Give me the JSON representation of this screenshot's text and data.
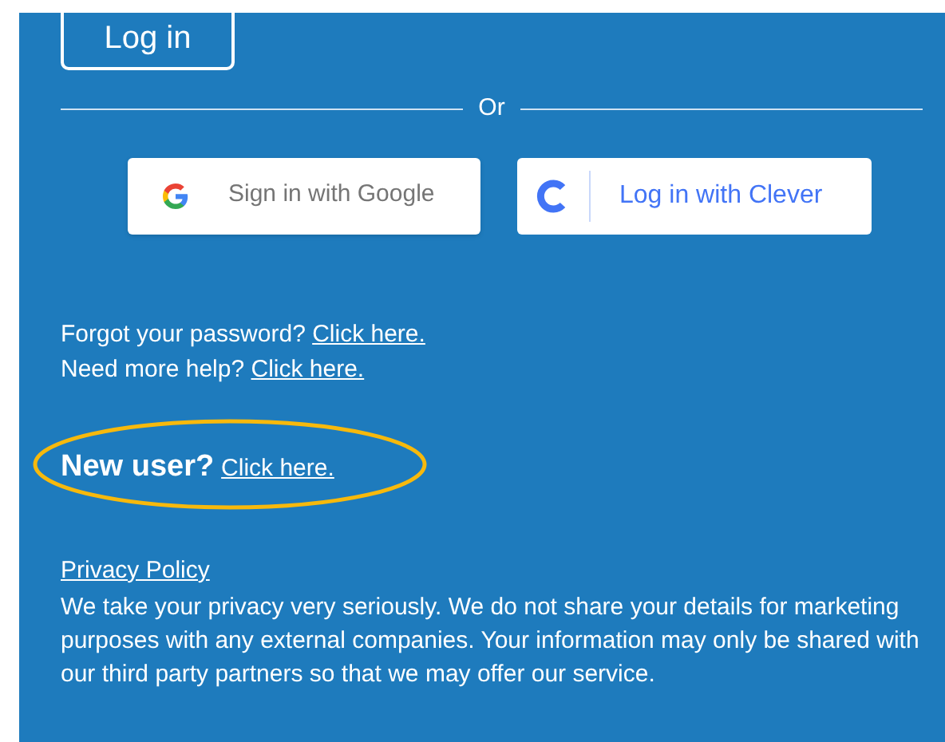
{
  "login_button": {
    "label": "Log in"
  },
  "divider": {
    "label": "Or"
  },
  "sso_buttons": [
    {
      "kind": "google",
      "label": "Sign in with Google"
    },
    {
      "kind": "clever",
      "label": "Log in with Clever"
    }
  ],
  "help_lines": [
    {
      "text": "Forgot your password?",
      "link": "Click here."
    },
    {
      "text": "Need more help?",
      "link": "Click here."
    }
  ],
  "new_user": {
    "text": "New user?",
    "link": "Click here.",
    "highlighted": true
  },
  "privacy": {
    "link": "Privacy Policy",
    "text": "We take your privacy very seriously. We do not share your details for marketing purposes with any external companies. Your information may only be shared with our third party partners so that we may offer our service."
  }
}
